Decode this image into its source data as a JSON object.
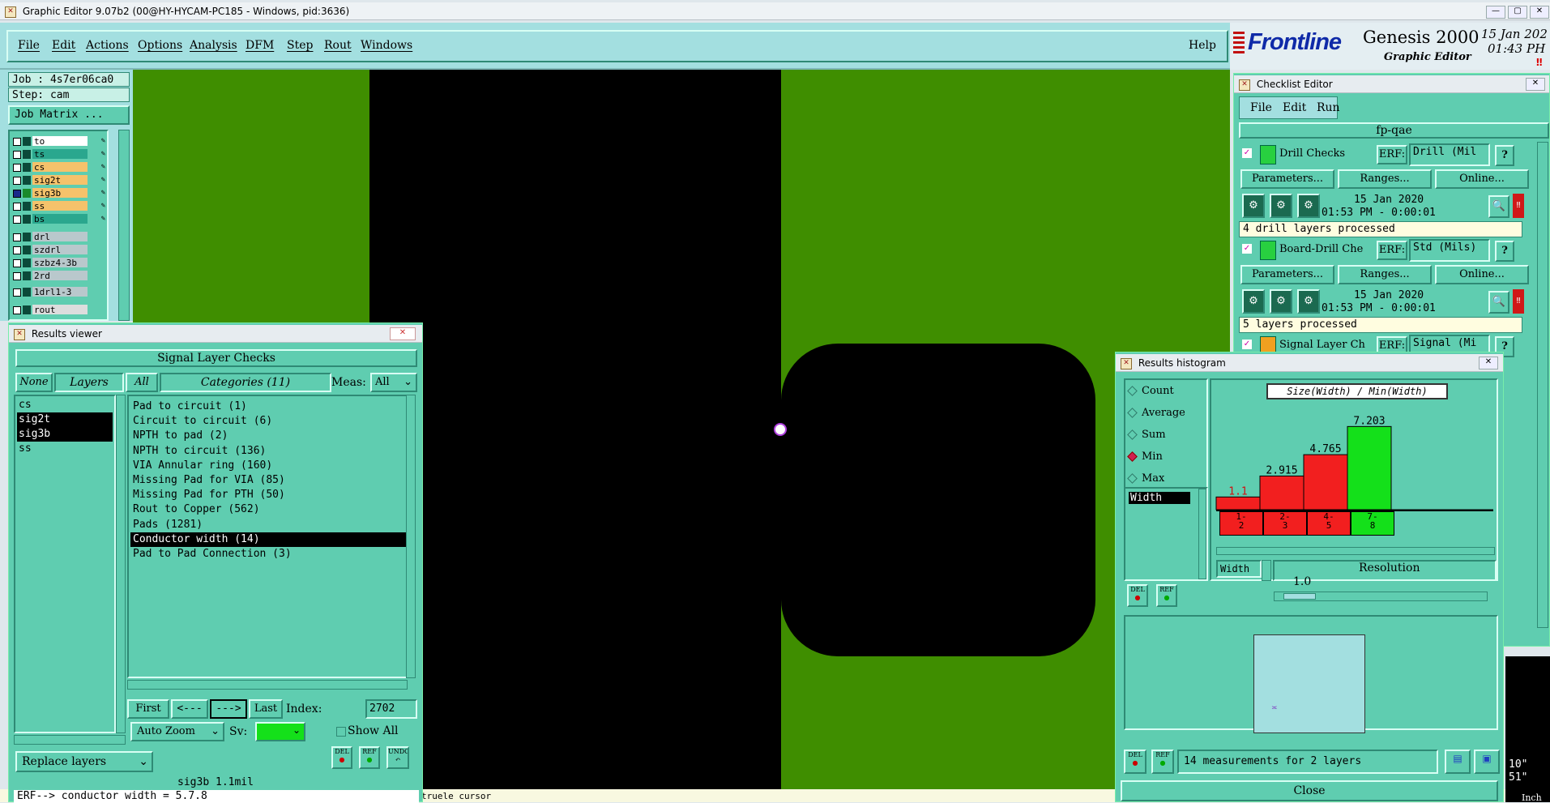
{
  "window": {
    "title": "Graphic Editor 9.07b2 (00@HY-HYCAM-PC185 - Windows, pid:3636)"
  },
  "menu": [
    "File",
    "Edit",
    "Actions",
    "Options",
    "Analysis",
    "DFM",
    "Step",
    "Rout",
    "Windows"
  ],
  "help": "Help",
  "brand": {
    "logo": "Frontline",
    "product": "Genesis 2000",
    "subtitle": "Graphic Editor",
    "date": "15 Jan 202",
    "time": "01:43 PH"
  },
  "job": {
    "job": "Job : 4s7er06ca0",
    "step": "Step: cam",
    "matrix": "Job Matrix ..."
  },
  "layers": [
    {
      "name": "to",
      "color": "#ffffff"
    },
    {
      "name": "ts",
      "color": "#2aa78e"
    },
    {
      "name": "cs",
      "color": "#f5c26b"
    },
    {
      "name": "sig2t",
      "color": "#f5c26b"
    },
    {
      "name": "sig3b",
      "color": "#f5c26b"
    },
    {
      "name": "ss",
      "color": "#f5c26b"
    },
    {
      "name": "bs",
      "color": "#2aa78e"
    },
    {
      "name": "drl",
      "color": "#b9c8cc"
    },
    {
      "name": "szdrl",
      "color": "#b9c8cc"
    },
    {
      "name": "szbz4-3b",
      "color": "#b9c8cc"
    },
    {
      "name": "2rd",
      "color": "#b9c8cc"
    },
    {
      "name": "1drl1-3",
      "color": "#b9c8cc"
    },
    {
      "name": "rout",
      "color": "#dddddd"
    }
  ],
  "colors": {
    "board": "#3f8e00",
    "pad": "#000000",
    "teal": "#5fcdb0",
    "red": "#f21f1f",
    "green": "#14e01a"
  },
  "results_viewer": {
    "title": "Results viewer",
    "header": "Signal Layer Checks",
    "none": "None",
    "layers_label": "Layers",
    "all": "All",
    "categories_label": "Categories (11)",
    "meas": "Meas:",
    "meas_value": "All",
    "layer_list": [
      "cs",
      "sig2t",
      "sig3b",
      "ss"
    ],
    "categories": [
      "Pad to circuit (1)",
      "Circuit to circuit (6)",
      "NPTH to pad (2)",
      "NPTH to circuit (136)",
      "VIA Annular ring (160)",
      "Missing Pad for VIA (85)",
      "Missing Pad for PTH (50)",
      "Rout to Copper (562)",
      "Pads (1281)",
      "Conductor width (14)",
      "Pad to Pad Connection (3)"
    ],
    "first": "First",
    "prev": "<---",
    "next": "--->",
    "last": "Last",
    "index_label": "Index:",
    "index_value": "2702",
    "zoom": "Auto Zoom",
    "sv": "Sv:",
    "show_all": "Show All",
    "replace": "Replace layers",
    "del": "DEL",
    "ref": "REF",
    "undo": "UNDO",
    "status": "sig3b 1.1mil",
    "erf": "ERF--> conductor width = 5.7.8"
  },
  "checklist": {
    "title": "Checklist Editor",
    "menu": [
      "File",
      "Edit",
      "Run"
    ],
    "name": "fp-qae",
    "erf": "ERF:",
    "parameters": "Parameters...",
    "ranges": "Ranges...",
    "online": "Online...",
    "checks": [
      {
        "name": "Drill Checks",
        "erf_value": "Drill (Mil",
        "date": "15 Jan 2020",
        "time": "01:53 PM - 0:00:01",
        "message": "4 drill layers processed"
      },
      {
        "name": "Board-Drill Che",
        "erf_value": "Std (Mils)",
        "date": "15 Jan 2020",
        "time": "01:53 PM - 0:00:01",
        "message": "5 layers processed"
      },
      {
        "name": "Signal Layer Ch",
        "erf_value": "Signal (Mi"
      }
    ]
  },
  "histogram": {
    "title": "Results histogram",
    "modes": [
      "Count",
      "Average",
      "Sum",
      "Min",
      "Max"
    ],
    "selected": "Min",
    "list_item": "Width",
    "chart_title": "Size(Width) / Min(Width)",
    "width_label": "Width",
    "resolution_label": "Resolution",
    "resolution_value": "1.0",
    "del": "DEL",
    "ref": "REF",
    "summary": "14 measurements for 2 layers",
    "close": "Close"
  },
  "chart_data": {
    "type": "bar",
    "title": "Size(Width) / Min(Width)",
    "categories": [
      "1-2",
      "2-3",
      "4-5",
      "7-8"
    ],
    "values": [
      1.1,
      2.915,
      4.765,
      7.203
    ],
    "value_labels": [
      "1.1",
      "2.915",
      "4.765",
      "7.203"
    ],
    "colors": [
      "#f21f1f",
      "#f21f1f",
      "#f21f1f",
      "#14e01a"
    ]
  },
  "status_bar": {
    "text": "truele cursor",
    "right": [
      "10\"",
      "51\""
    ],
    "right_bottom": "Inch"
  }
}
